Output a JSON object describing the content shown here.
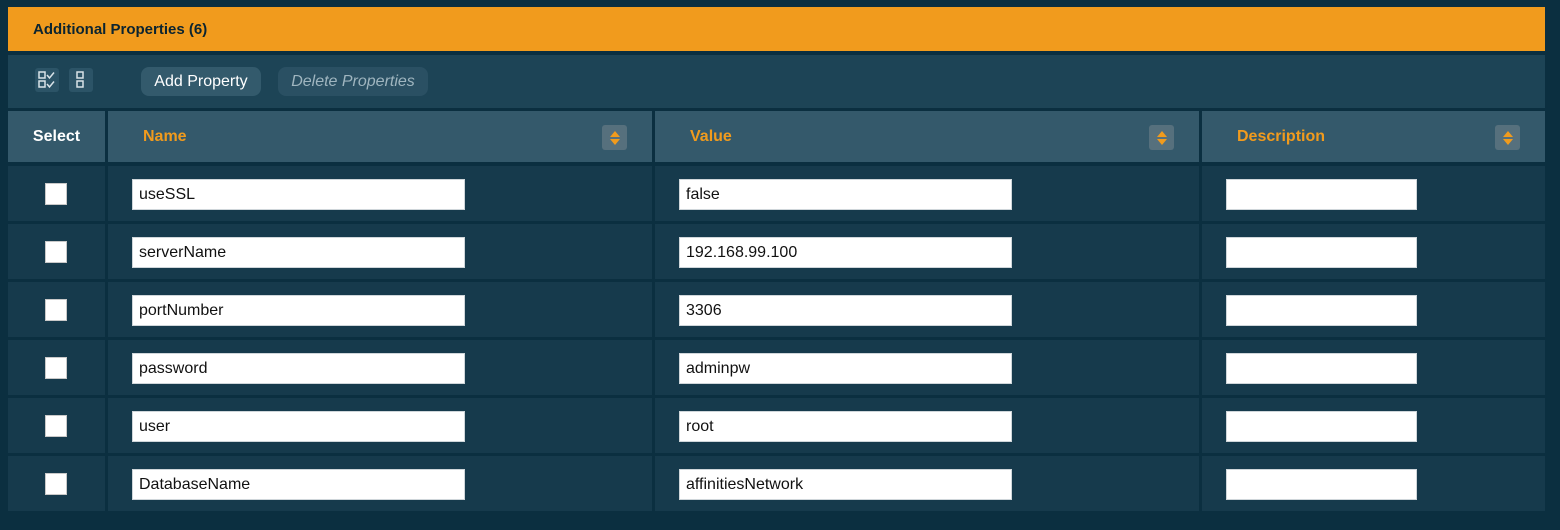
{
  "header": {
    "title": "Additional Properties (6)"
  },
  "toolbar": {
    "select_all_icon": "select-all-icon",
    "deselect_all_icon": "deselect-all-icon",
    "add_label": "Add Property",
    "delete_label": "Delete Properties"
  },
  "columns": {
    "select": "Select",
    "name": "Name",
    "value": "Value",
    "description": "Description"
  },
  "rows": [
    {
      "name": "useSSL",
      "value": "false",
      "description": ""
    },
    {
      "name": "serverName",
      "value": "192.168.99.100",
      "description": ""
    },
    {
      "name": "portNumber",
      "value": "3306",
      "description": ""
    },
    {
      "name": "password",
      "value": "adminpw",
      "description": ""
    },
    {
      "name": "user",
      "value": "root",
      "description": ""
    },
    {
      "name": "DatabaseName",
      "value": "affinitiesNetwork",
      "description": ""
    }
  ],
  "colors": {
    "accent": "#f19b1d",
    "background": "#0b2f40",
    "header_cell": "#34596b",
    "row_cell": "#163a4c"
  }
}
